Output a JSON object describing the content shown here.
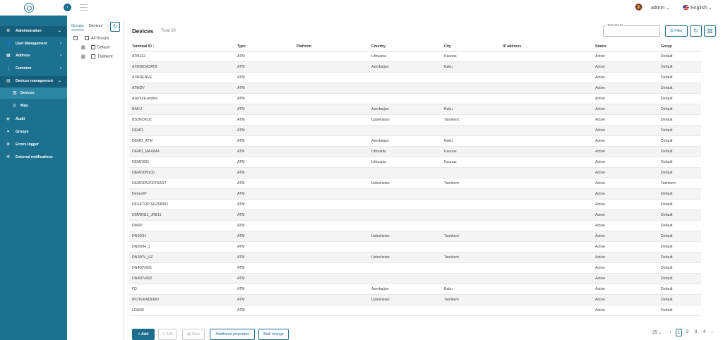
{
  "header": {
    "user": "admin",
    "language": "English",
    "collapse_icon": "‹"
  },
  "sidebar": {
    "items": [
      {
        "label": "Administration",
        "icon": "⚙",
        "chev": "⌄"
      },
      {
        "label": "User Management",
        "icon": "👤",
        "chev": "›"
      },
      {
        "label": "Address",
        "icon": "▦",
        "chev": "›"
      },
      {
        "label": "Common",
        "icon": "⋮",
        "chev": "›"
      },
      {
        "label": "Devices management",
        "icon": "▤",
        "chev": "⌄"
      },
      {
        "label": "Devices",
        "icon": "▥",
        "chev": ""
      },
      {
        "label": "Map",
        "icon": "◎",
        "chev": ""
      },
      {
        "label": "Audit",
        "icon": "◈",
        "chev": ""
      },
      {
        "label": "Groups",
        "icon": "⚭",
        "chev": ""
      },
      {
        "label": "Errors logger",
        "icon": "⊗",
        "chev": ""
      },
      {
        "label": "External notifications",
        "icon": "✲",
        "chev": ""
      }
    ]
  },
  "groups_panel": {
    "tabs": [
      "Groups",
      "Devices"
    ],
    "refresh_icon": "↻",
    "tree": [
      "All Groups",
      "Default",
      "Tashkent"
    ]
  },
  "main": {
    "title": "Devices",
    "total": "Total 90",
    "terminal_id_label": "Terminal ID",
    "filter_label": "Filter",
    "refresh_icon": "↻",
    "columns_icon": "▥"
  },
  "table": {
    "columns": [
      "Terminal ID ↑",
      "Type",
      "Platform",
      "Country",
      "City",
      "IP address",
      "Status",
      "Group"
    ],
    "rows": [
      [
        "ATM112",
        "ATM",
        "",
        "Lithuania",
        "Kaunas",
        "",
        "Active",
        "Default"
      ],
      [
        "ATMDEMOATB",
        "ATM",
        "",
        "Azerbaijan",
        "Baku",
        "",
        "Active",
        "Default"
      ],
      [
        "ATMDENVE",
        "ATM",
        "",
        "",
        "",
        "",
        "Active",
        "Default"
      ],
      [
        "ATMDV",
        "ATM",
        "",
        "",
        "",
        "",
        "Active",
        "Default"
      ],
      [
        "Azerturk-profiex",
        "ATM",
        "",
        "",
        "",
        "",
        "Active",
        "Default"
      ],
      [
        "BAKU",
        "ATM",
        "",
        "Azerbaijan",
        "Baku",
        "",
        "Active",
        "Default"
      ],
      [
        "BS2NCRUZ",
        "ATM",
        "",
        "Uzbekistan",
        "Tashkent",
        "",
        "Active",
        "Default"
      ],
      [
        "DEMO",
        "ATM",
        "",
        "",
        "",
        "",
        "Active",
        "Default"
      ],
      [
        "DEMO_ATM",
        "ATM",
        "",
        "Azerbaijan",
        "Baku",
        "",
        "Active",
        "Default"
      ],
      [
        "DEMO_MAXIMA",
        "ATM",
        "",
        "Lithuania",
        "Kaunas",
        "",
        "Active",
        "Default"
      ],
      [
        "DEMO001",
        "ATM",
        "",
        "Lithuania",
        "Kaunas",
        "",
        "Active",
        "Default"
      ],
      [
        "DEMODN100",
        "ATM",
        "",
        "",
        "",
        "",
        "Active",
        "Default"
      ],
      [
        "DEMODN200TRAST",
        "ATM",
        "",
        "Uzbekistan",
        "Tashkent",
        "",
        "Active",
        "Tashkent"
      ],
      [
        "DemoXP",
        "ATM",
        "",
        "",
        "",
        "",
        "Active",
        "Default"
      ],
      [
        "DESKTOP-SH2SBRD",
        "ATM",
        "",
        "",
        "",
        "",
        "Active",
        "Default"
      ],
      [
        "DMWIN11_JRE11",
        "ATM",
        "",
        "",
        "",
        "",
        "Active",
        "Default"
      ],
      [
        "DMXP",
        "ATM",
        "",
        "",
        "",
        "",
        "Active",
        "Default"
      ],
      [
        "DN200H",
        "ATM",
        "",
        "Uzbekistan",
        "Tashkent",
        "",
        "Active",
        "Default"
      ],
      [
        "DN200H_1",
        "ATM",
        "",
        "",
        "",
        "",
        "Active",
        "Default"
      ],
      [
        "DN200V_UZ",
        "ATM",
        "",
        "Uzbekistan",
        "Tashkent",
        "",
        "Active",
        "Default"
      ],
      [
        "DN400V001",
        "ATM",
        "",
        "",
        "",
        "",
        "Active",
        "Default"
      ],
      [
        "DN400V002",
        "ATM",
        "",
        "",
        "",
        "",
        "Active",
        "Default"
      ],
      [
        "FD",
        "ATM",
        "",
        "Azerbaijan",
        "Baku",
        "",
        "Active",
        "Default"
      ],
      [
        "IPOTEKADEMO",
        "ATM",
        "",
        "Uzbekistan",
        "Tashkent",
        "",
        "Active",
        "Default"
      ],
      [
        "LOAD0",
        "ATM",
        "",
        "",
        "",
        "",
        "Active",
        "Default"
      ]
    ]
  },
  "footer": {
    "add": "+ Add",
    "edit": "✎ Edit",
    "view": "▤ View",
    "additional": "Additional properties",
    "bulk": "Bulk change",
    "page_size": "25 ⌄",
    "prev": "‹",
    "next": "›",
    "pages": [
      "1",
      "2",
      "3",
      "4"
    ]
  }
}
